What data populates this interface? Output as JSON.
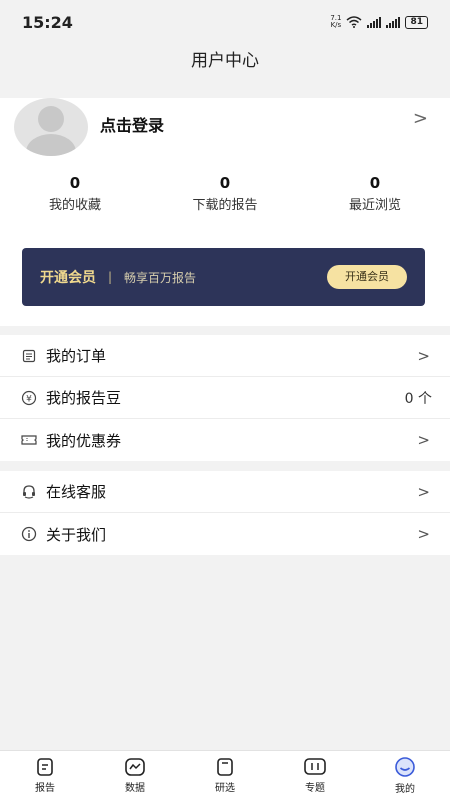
{
  "status": {
    "time": "15:24",
    "net_speed_top": "7.1",
    "net_speed_bottom": "K/s",
    "battery": "81"
  },
  "header": {
    "title": "用户中心"
  },
  "profile": {
    "login_label": "点击登录",
    "stats": [
      {
        "value": "0",
        "label": "我的收藏"
      },
      {
        "value": "0",
        "label": "下载的报告"
      },
      {
        "value": "0",
        "label": "最近浏览"
      }
    ]
  },
  "vip": {
    "title": "开通会员",
    "separator": "|",
    "subtitle": "畅享百万报告",
    "button": "开通会员"
  },
  "menu_group1": {
    "items": [
      {
        "label": "我的订单",
        "icon": "order-icon"
      },
      {
        "label": "我的报告豆",
        "icon": "yen-icon",
        "count": "0 个"
      },
      {
        "label": "我的优惠券",
        "icon": "coupon-icon"
      }
    ]
  },
  "menu_group2": {
    "items": [
      {
        "label": "在线客服",
        "icon": "headset-icon"
      },
      {
        "label": "关于我们",
        "icon": "info-icon"
      }
    ]
  },
  "chevron": ">",
  "tabbar": {
    "items": [
      {
        "label": "报告",
        "icon": "report-icon"
      },
      {
        "label": "数据",
        "icon": "data-icon"
      },
      {
        "label": "研选",
        "icon": "selection-icon"
      },
      {
        "label": "专题",
        "icon": "topic-icon"
      },
      {
        "label": "我的",
        "icon": "profile-icon",
        "active": true
      }
    ]
  },
  "colors": {
    "vip_bg": "#2d3459",
    "vip_button": "#f6e2a2",
    "active_tab": "#3b5bd9"
  }
}
